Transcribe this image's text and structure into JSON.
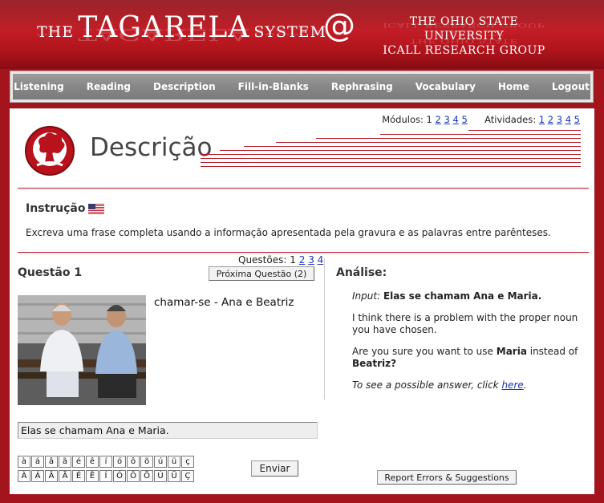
{
  "header": {
    "brand_the": "THE",
    "brand_tagarela": "TAGARELA",
    "brand_system": "SYSTEM",
    "at_symbol": "@",
    "university": "THE OHIO STATE UNIVERSITY",
    "group": "ICALL RESEARCH GROUP"
  },
  "nav": {
    "items": [
      "Listening",
      "Reading",
      "Description",
      "Fill-in-Blanks",
      "Rephrasing",
      "Vocabulary",
      "Home",
      "Logout"
    ]
  },
  "modules": {
    "label": "Módulos:",
    "current": "1",
    "links": [
      "2",
      "3",
      "4",
      "5"
    ]
  },
  "activities": {
    "label": "Atividades:",
    "links": [
      "1",
      "2",
      "3",
      "4",
      "5"
    ]
  },
  "page": {
    "title": "Descrição"
  },
  "instruction": {
    "heading": "Instrução",
    "text": "Excreva uma frase completa usando a informação apresentada pela gravura e as palavras entre parênteses."
  },
  "questions": {
    "label": "Questões:",
    "current": "1",
    "links": [
      "2",
      "3",
      "4"
    ]
  },
  "question": {
    "heading": "Questão 1",
    "next_label": "Próxima Questão (2)",
    "prompt": "chamar-se - Ana e Beatriz",
    "answer_value": "Elas se chamam Ana e Maria.",
    "send_label": "Enviar"
  },
  "keyboard": {
    "lower": [
      "à",
      "á",
      "â",
      "ã",
      "é",
      "ê",
      "í",
      "ó",
      "ô",
      "õ",
      "ú",
      "ü",
      "ç"
    ],
    "upper": [
      "À",
      "Á",
      "Â",
      "Ã",
      "É",
      "Ê",
      "Í",
      "Ó",
      "Ô",
      "Õ",
      "Ú",
      "Ü",
      "Ç"
    ]
  },
  "analysis": {
    "heading": "Análise:",
    "input_label": "Input:",
    "input_value": "Elas se chamam Ana e Maria.",
    "message1": "I think there is a problem with the proper noun you have chosen.",
    "message2_pre": "Are you sure you want to use ",
    "message2_word1": "Maria",
    "message2_mid": " instead of ",
    "message2_word2": "Beatriz",
    "message2_end": "?",
    "hint_pre": "To see a possible answer, click ",
    "hint_link": "here",
    "hint_end": "."
  },
  "report": {
    "label": "Report Errors & Suggestions"
  },
  "colors": {
    "brand_red": "#a4141c",
    "nav_gray": "#878787",
    "link_blue": "#1a35b8"
  }
}
